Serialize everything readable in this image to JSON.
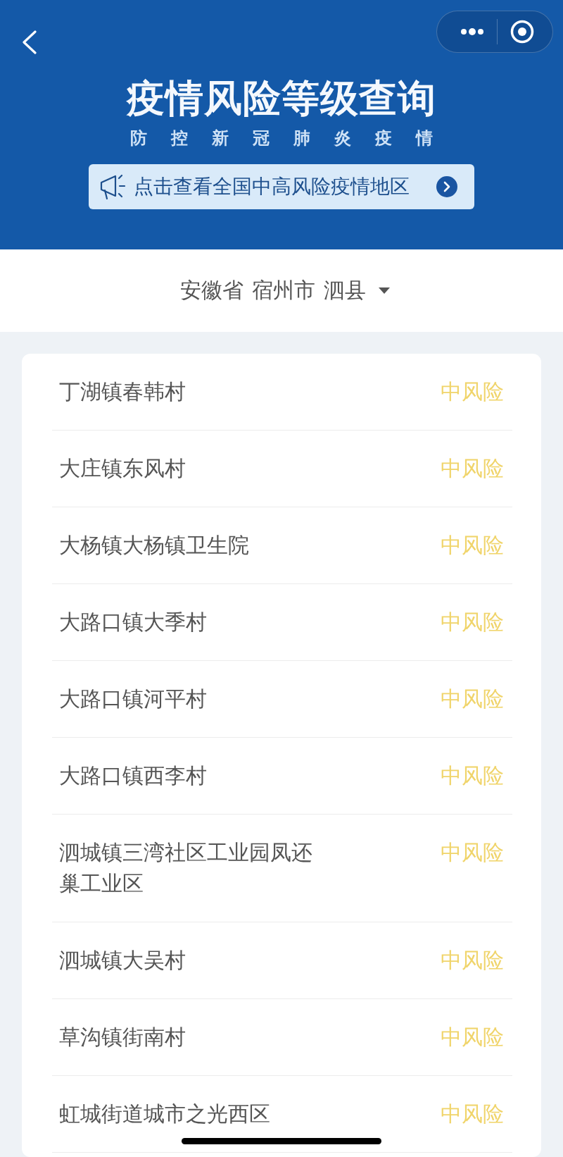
{
  "header": {
    "title": "疫情风险等级查询",
    "subtitle": "防控新冠肺炎疫情",
    "banner": {
      "text": "点击查看全国中高风险疫情地区"
    }
  },
  "region_selector": {
    "parts": [
      "安徽省",
      "宿州市",
      "泗县"
    ]
  },
  "areas": [
    {
      "name": "丁湖镇春韩村",
      "risk": "中风险"
    },
    {
      "name": "大庄镇东风村",
      "risk": "中风险"
    },
    {
      "name": "大杨镇大杨镇卫生院",
      "risk": "中风险"
    },
    {
      "name": "大路口镇大季村",
      "risk": "中风险"
    },
    {
      "name": "大路口镇河平村",
      "risk": "中风险"
    },
    {
      "name": "大路口镇西李村",
      "risk": "中风险"
    },
    {
      "name": "泗城镇三湾社区工业园凤还巢工业区",
      "risk": "中风险"
    },
    {
      "name": "泗城镇大吴村",
      "risk": "中风险"
    },
    {
      "name": "草沟镇街南村",
      "risk": "中风险"
    },
    {
      "name": "虹城街道城市之光西区",
      "risk": "中风险"
    }
  ]
}
